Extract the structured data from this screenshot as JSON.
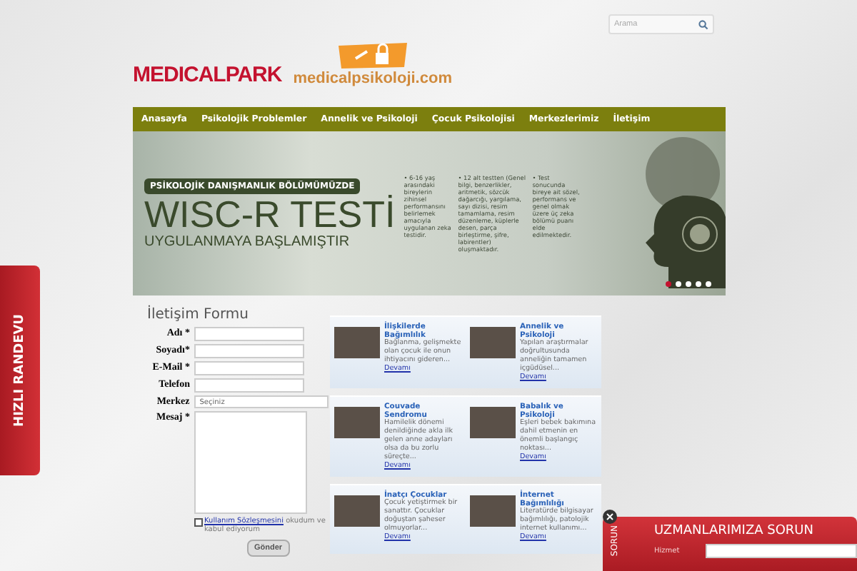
{
  "header": {
    "search": {
      "placeholder": "Arama"
    },
    "logo": "MEDICALPARK",
    "site_logo": "medicalpsikoloji.com"
  },
  "nav": [
    "Anasayfa",
    "Psikolojik Problemler",
    "Annelik ve Psikoloji",
    "Çocuk Psikolojisi",
    "Merkezlerimiz",
    "İletişim"
  ],
  "banner": {
    "badge": "PSİKOLOJİK DANIŞMANLIK BÖLÜMÜMÜZDE",
    "title": "WISC-R TESTİ",
    "subtitle": "UYGULANMAYA BAŞLAMIŞTIR",
    "bullets": [
      "• 6-16 yaş arasındaki bireylerin zihinsel performansını belirlemek amacıyla uygulanan zeka testidir.",
      "• 12 alt testten (Genel bilgi, benzerlikler, aritmetik, sözcük dağarcığı, yargılama, sayı dizisi, resim tamamlama, resim düzenleme, küplerle desen, parça birleştirme, şifre, labirentler) oluşmaktadır.",
      "• Test sonucunda bireye ait sözel, performans ve genel olmak üzere üç zeka bölümü puanı elde edilmektedir."
    ],
    "dots": [
      {
        "selected": true
      },
      {
        "selected": false
      },
      {
        "selected": false
      },
      {
        "selected": false
      },
      {
        "selected": false
      }
    ]
  },
  "side_tab": "HIZLI RANDEVU",
  "form": {
    "title": "İletişim Formu",
    "fields": [
      {
        "label": "Adı *",
        "kind": "text"
      },
      {
        "label": "Soyadı*",
        "kind": "text"
      },
      {
        "label": "E-Mail *",
        "kind": "text"
      },
      {
        "label": "Telefon",
        "kind": "text"
      },
      {
        "label": "Merkez",
        "kind": "select",
        "value": "Seçiniz"
      },
      {
        "label": "Mesaj *",
        "kind": "textarea"
      }
    ],
    "agreement": {
      "checked": false,
      "link": "Kullanım Sözleşmesini",
      "text": "okudum ve kabul ediyorum"
    },
    "submit": "Gönder"
  },
  "cards": [
    {
      "title": "İlişkilerde Bağımlılık",
      "text": "Bağlanma, gelişmekte olan çocuk ile onun ihtiyacını gideren...",
      "link": "Devamı"
    },
    {
      "title": "Annelik ve Psikoloji",
      "text": "Yapılan araştırmalar doğrultusunda anneliğin tamamen içgüdüsel...",
      "link": "Devamı"
    },
    {
      "title": "Couvade Sendromu",
      "text": "Hamilelik dönemi denildiğinde akla ilk gelen anne adayları olsa da bu zorlu süreçte...",
      "link": "Devamı"
    },
    {
      "title": "Babalık ve Psikoloji",
      "text": "Eşleri bebek bakımına dahil etmenin en önemli başlangıç noktası...",
      "link": "Devamı"
    },
    {
      "title": "İnatçı Çocuklar",
      "text": "Çocuk yetiştirmek bir sanattır. Çocuklar doğuştan şaheser olmuyorlar...",
      "link": "Devamı"
    },
    {
      "title": "İnternet Bağımlılığı",
      "text": "Literatürde bilgisayar bağımlılığı, patolojik internet kullanımı...",
      "link": "Devamı"
    }
  ],
  "ask_panel": {
    "side": "SORUN",
    "title": "UZMANLARIMIZA SORUN",
    "field_label": "Hizmet"
  }
}
